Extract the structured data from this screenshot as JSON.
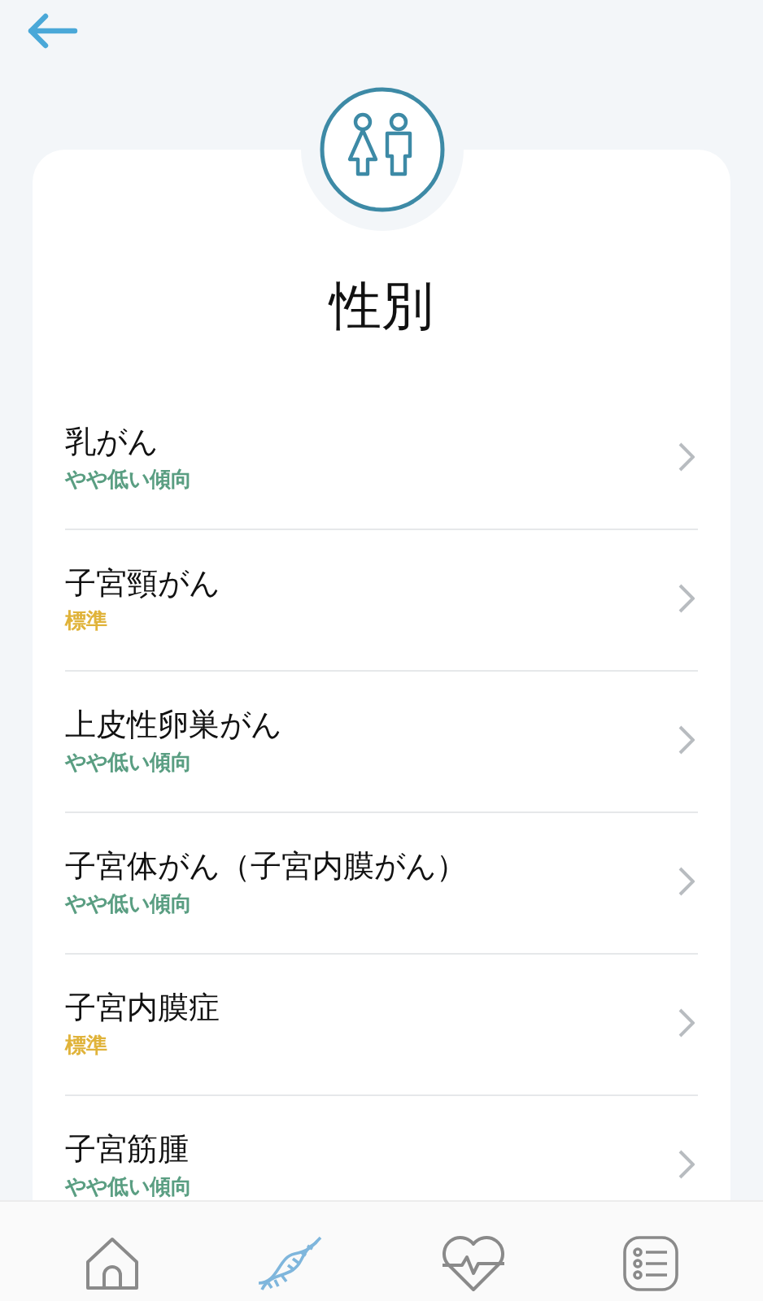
{
  "title": "性別",
  "items": [
    {
      "name": "乳がん",
      "result": "やや低い傾向",
      "color": "#5a9e82"
    },
    {
      "name": "子宮頸がん",
      "result": "標準",
      "color": "#e0b33a"
    },
    {
      "name": "上皮性卵巣がん",
      "result": "やや低い傾向",
      "color": "#5a9e82"
    },
    {
      "name": "子宮体がん（子宮内膜がん）",
      "result": "やや低い傾向",
      "color": "#5a9e82"
    },
    {
      "name": "子宮内膜症",
      "result": "標準",
      "color": "#e0b33a"
    },
    {
      "name": "子宮筋腫",
      "result": "やや低い傾向",
      "color": "#5a9e82"
    }
  ],
  "nav": [
    {
      "kind": "home",
      "selected": false
    },
    {
      "kind": "dna",
      "selected": true
    },
    {
      "kind": "heart",
      "selected": false
    },
    {
      "kind": "list",
      "selected": false
    }
  ]
}
